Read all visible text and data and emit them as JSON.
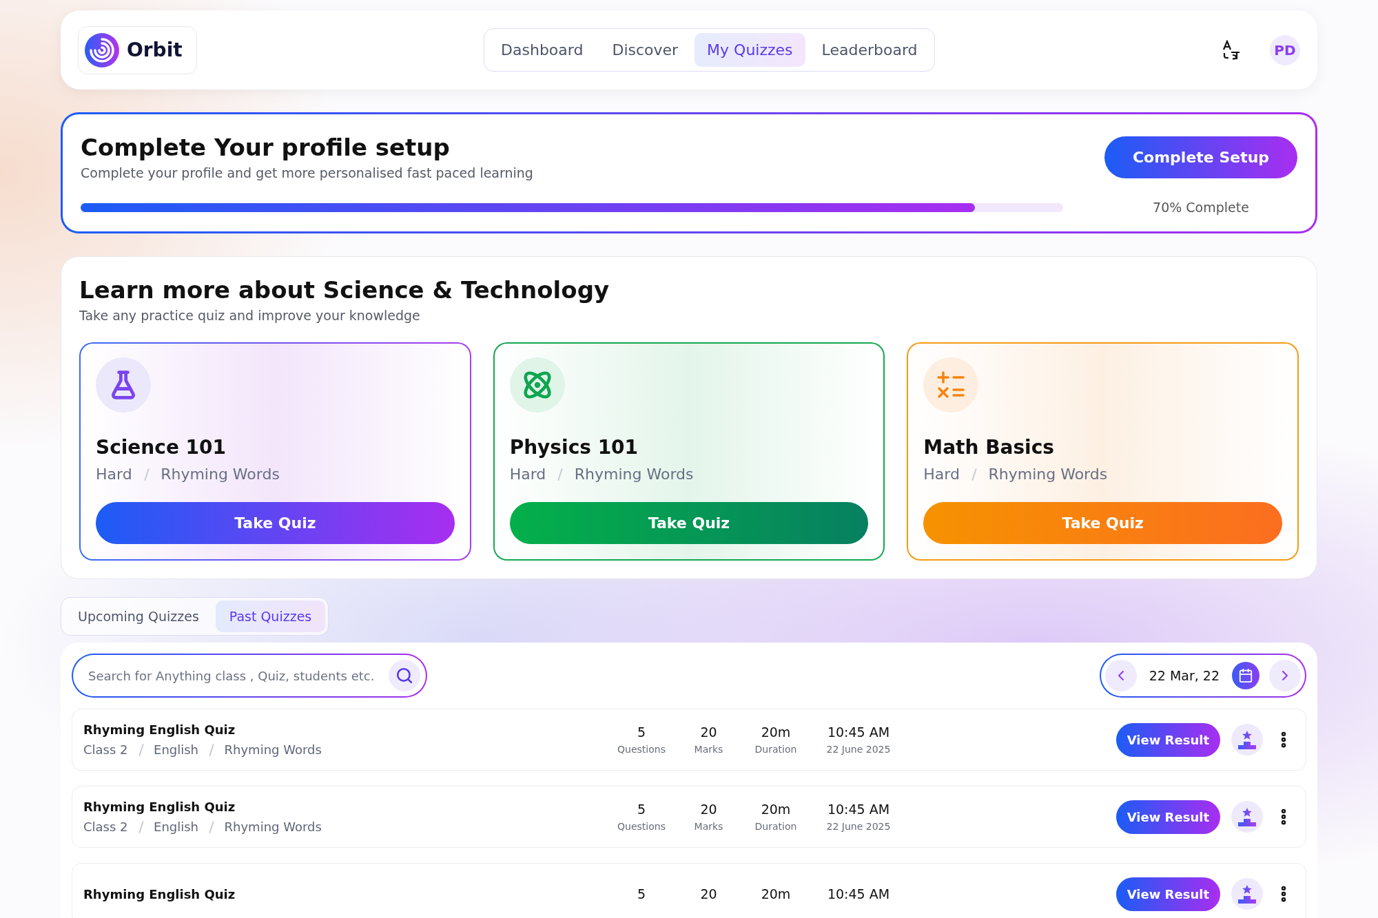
{
  "header": {
    "logo": "Orbit",
    "nav": [
      {
        "label": "Dashboard",
        "selected": false
      },
      {
        "label": "Discover",
        "selected": false
      },
      {
        "label": "My Quizzes",
        "selected": true
      },
      {
        "label": "Leaderboard",
        "selected": false
      }
    ],
    "avatar": "PD"
  },
  "profile": {
    "title": "Complete Your profile setup",
    "subtitle": "Complete your profile and get more personalised fast paced learning",
    "level": 0.91,
    "button": "Complete Setup",
    "reading": "70% Complete"
  },
  "learn": {
    "title": "Learn more about Science & Technology",
    "subtitle": "Take any practice quiz and improve your knowledge",
    "cards": [
      {
        "kind": "science",
        "title": "Science 101",
        "difficulty": "Hard",
        "topic": "Rhyming Words",
        "button": "Take Quiz"
      },
      {
        "kind": "physics",
        "title": "Physics 101",
        "difficulty": "Hard",
        "topic": "Rhyming Words",
        "button": "Take Quiz"
      },
      {
        "kind": "math",
        "title": "Math Basics",
        "difficulty": "Hard",
        "topic": "Rhyming Words",
        "button": "Take Quiz"
      }
    ]
  },
  "tabs": [
    {
      "label": "Upcoming Quizzes",
      "selected": false
    },
    {
      "label": "Past Quizzes",
      "selected": true
    }
  ],
  "search": {
    "placeholder": "Search for Anything class , Quiz, students etc."
  },
  "date": "22 Mar, 22",
  "quizzes": [
    {
      "title": "Rhyming English Quiz",
      "meta": [
        "Class 2",
        "English",
        "Rhyming Words"
      ],
      "stats": [
        {
          "value": "5",
          "label": "Questions"
        },
        {
          "value": "20",
          "label": "Marks"
        },
        {
          "value": "20m",
          "label": "Duration"
        },
        {
          "value": "10:45 AM",
          "label": "22 June 2025"
        }
      ],
      "button": "View Result"
    },
    {
      "title": "Rhyming English Quiz",
      "meta": [
        "Class 2",
        "English",
        "Rhyming Words"
      ],
      "stats": [
        {
          "value": "5",
          "label": "Questions"
        },
        {
          "value": "20",
          "label": "Marks"
        },
        {
          "value": "20m",
          "label": "Duration"
        },
        {
          "value": "10:45 AM",
          "label": "22 June 2025"
        }
      ],
      "button": "View Result"
    },
    {
      "title": "Rhyming English Quiz",
      "stats": [
        {
          "value": "5"
        },
        {
          "value": "20"
        },
        {
          "value": "20m"
        },
        {
          "value": "10:45 AM"
        }
      ],
      "button": "View Result"
    }
  ]
}
